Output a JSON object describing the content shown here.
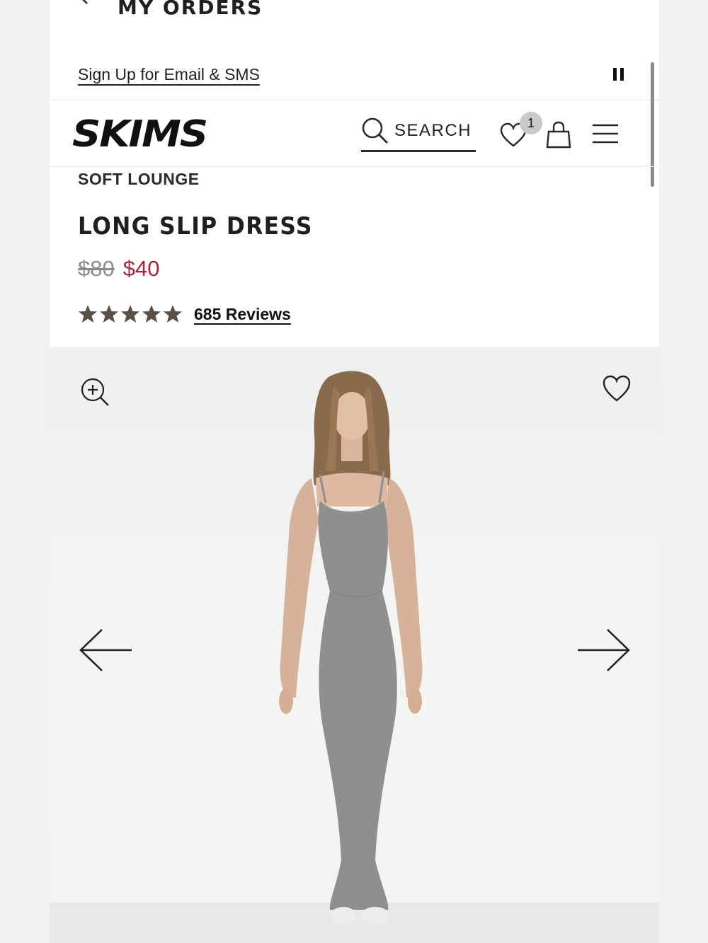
{
  "orders_bar": {
    "title": "MY ORDERS"
  },
  "promo": {
    "signup_label": "Sign Up for Email & SMS"
  },
  "header": {
    "brand": "SKIMS",
    "search_label": "SEARCH",
    "wishlist_count": "1"
  },
  "product": {
    "collection": "SOFT LOUNGE",
    "name": "LONG SLIP DRESS",
    "price_original": "$80",
    "price_sale": "$40",
    "rating": 5,
    "reviews_label": "685 Reviews"
  },
  "colors": {
    "sale_price": "#b0213d",
    "star": "#5a5048",
    "dress": "#8f8f90"
  },
  "icons": {
    "back": "arrow-left-icon",
    "pause": "pause-icon",
    "search": "search-icon",
    "wishlist": "heart-icon",
    "bag": "shopping-bag-icon",
    "menu": "hamburger-menu-icon",
    "zoom": "zoom-in-icon",
    "favorite": "heart-icon",
    "prev": "arrow-left-icon",
    "next": "arrow-right-icon"
  }
}
